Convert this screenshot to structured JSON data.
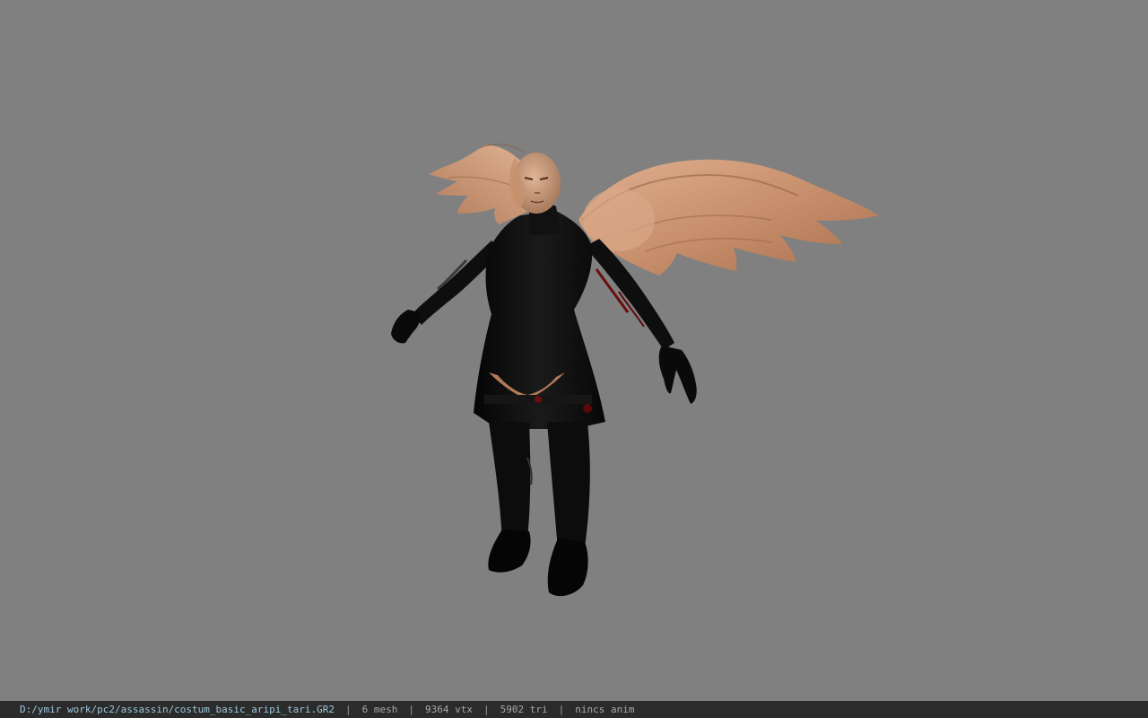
{
  "viewport": {
    "background_color": "#808080",
    "model": {
      "description_icon": "winged-assassin-model",
      "wing_color": "#c8906c",
      "armor_color": "#0d0d0d",
      "accent_color": "#7a1010",
      "skin_color": "#caa080"
    }
  },
  "status_bar": {
    "file_path": "D:/ymir work/pc2/assassin/costum_basic_aripi_tari.GR2",
    "separator": "|",
    "mesh": "6 mesh",
    "vertices": "9364 vtx",
    "triangles": "5902 tri",
    "animation": "nincs anim"
  }
}
